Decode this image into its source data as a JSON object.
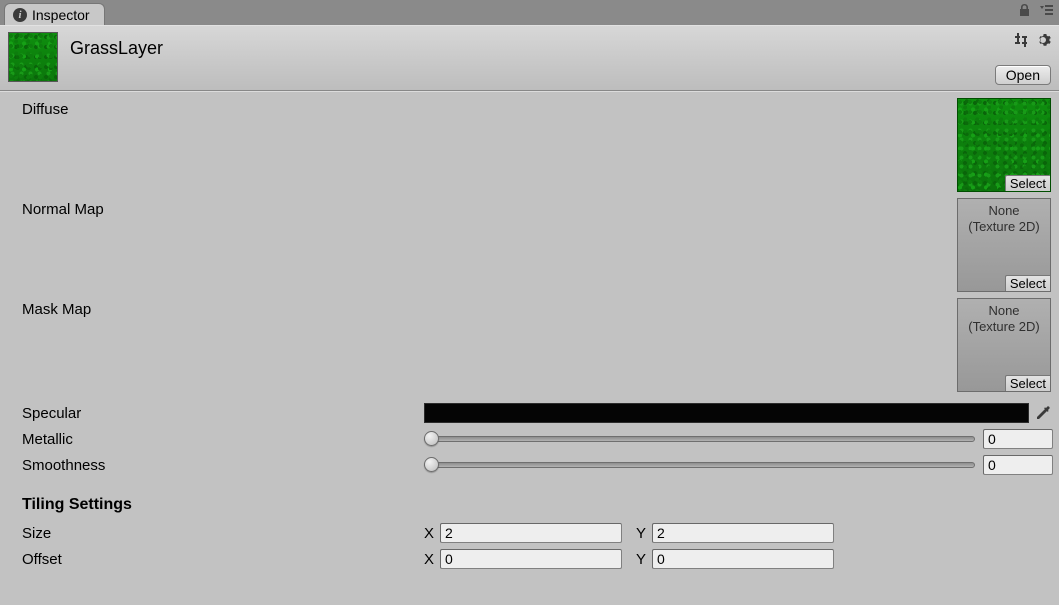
{
  "tab": {
    "title": "Inspector"
  },
  "header": {
    "assetName": "GrassLayer",
    "openLabel": "Open"
  },
  "texSlots": {
    "diffuse": {
      "label": "Diffuse",
      "noneText": "",
      "selectLabel": "Select"
    },
    "normal": {
      "label": "Normal Map",
      "noneText": "None\n(Texture 2D)",
      "selectLabel": "Select"
    },
    "mask": {
      "label": "Mask Map",
      "noneText": "None\n(Texture 2D)",
      "selectLabel": "Select"
    }
  },
  "specular": {
    "label": "Specular",
    "color": "#050505"
  },
  "sliders": {
    "metallic": {
      "label": "Metallic",
      "value": "0"
    },
    "smoothness": {
      "label": "Smoothness",
      "value": "0"
    }
  },
  "tiling": {
    "header": "Tiling Settings",
    "size": {
      "label": "Size",
      "xLabel": "X",
      "x": "2",
      "yLabel": "Y",
      "y": "2"
    },
    "offset": {
      "label": "Offset",
      "xLabel": "X",
      "x": "0",
      "yLabel": "Y",
      "y": "0"
    }
  }
}
